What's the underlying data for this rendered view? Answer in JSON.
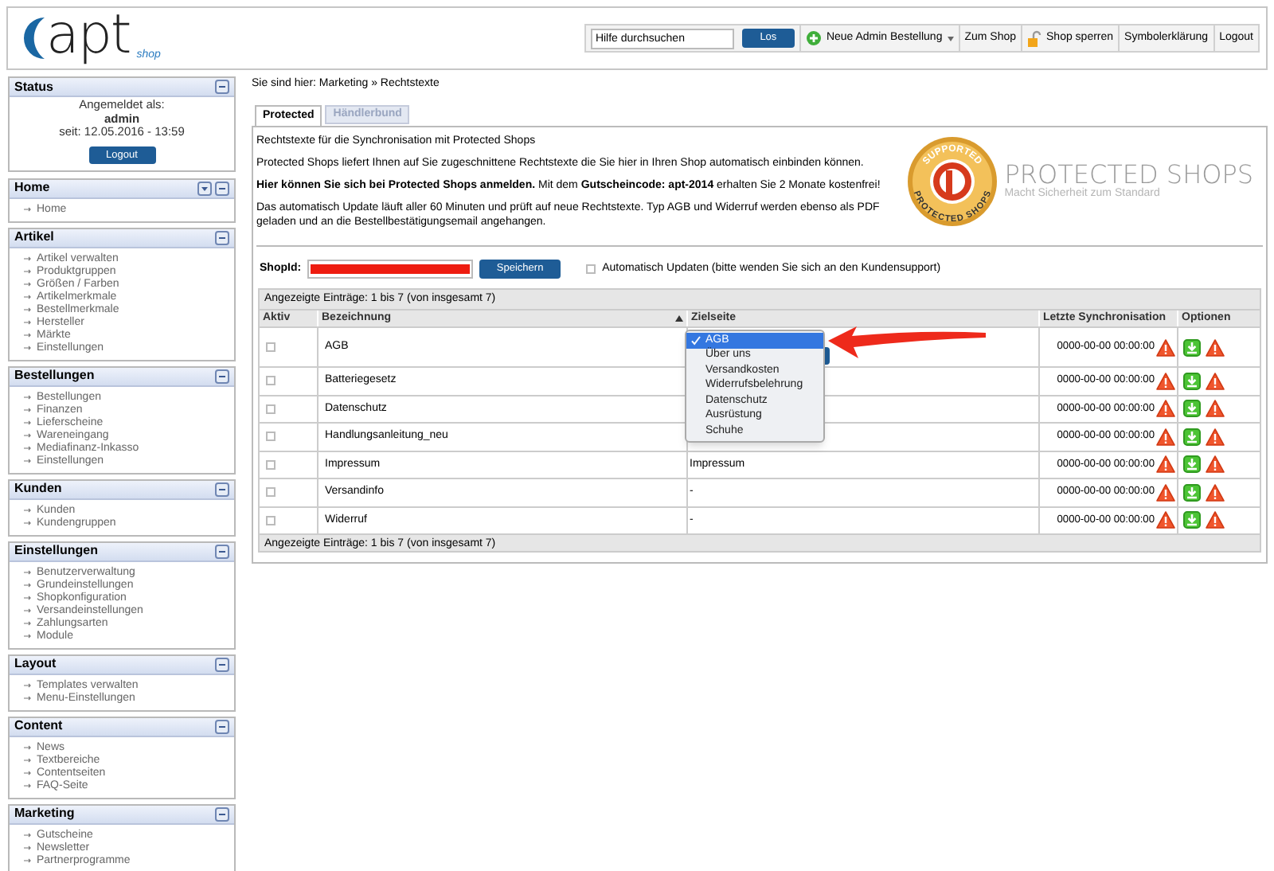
{
  "logo": {
    "brand": "apt",
    "sub": "shop"
  },
  "header": {
    "search": {
      "placeholder": "Hilfe durchsuchen"
    },
    "search_button": "Los",
    "toolbar": [
      {
        "kind": "add",
        "label": "Neue Admin Bestellung",
        "dropdown": true
      },
      {
        "kind": "plain",
        "label": "Zum Shop",
        "dropdown": false
      },
      {
        "kind": "lock",
        "label": "Shop sperren",
        "dropdown": false
      },
      {
        "kind": "plain",
        "label": "Symbolerklärung",
        "dropdown": false
      },
      {
        "kind": "plain",
        "label": "Logout",
        "dropdown": false
      }
    ]
  },
  "sidebar": {
    "status": {
      "title": "Status",
      "line1": "Angemeldet als:",
      "user": "admin",
      "since": "seit: 12.05.2016 - 13:59",
      "button": "Logout"
    },
    "panels": [
      {
        "title": "Home",
        "menu_toggle": true,
        "items": [
          "Home"
        ]
      },
      {
        "title": "Artikel",
        "menu_toggle": false,
        "items": [
          "Artikel verwalten",
          "Produktgruppen",
          "Größen / Farben",
          "Artikelmerkmale",
          "Bestellmerkmale",
          "Hersteller",
          "Märkte",
          "Einstellungen"
        ]
      },
      {
        "title": "Bestellungen",
        "menu_toggle": false,
        "items": [
          "Bestellungen",
          "Finanzen",
          "Lieferscheine",
          "Wareneingang",
          "Mediafinanz-Inkasso",
          "Einstellungen"
        ]
      },
      {
        "title": "Kunden",
        "menu_toggle": false,
        "items": [
          "Kunden",
          "Kundengruppen"
        ]
      },
      {
        "title": "Einstellungen",
        "menu_toggle": false,
        "items": [
          "Benutzerverwaltung",
          "Grundeinstellungen",
          "Shopkonfiguration",
          "Versandeinstellungen",
          "Zahlungsarten",
          "Module"
        ]
      },
      {
        "title": "Layout",
        "menu_toggle": false,
        "items": [
          "Templates verwalten",
          "Menu-Einstellungen"
        ]
      },
      {
        "title": "Content",
        "menu_toggle": false,
        "items": [
          "News",
          "Textbereiche",
          "Contentseiten",
          "FAQ-Seite"
        ]
      },
      {
        "title": "Marketing",
        "menu_toggle": false,
        "items": [
          "Gutscheine",
          "Newsletter",
          "Partnerprogramme"
        ]
      }
    ]
  },
  "breadcrumb": "Sie sind hier: Marketing » Rechtstexte",
  "tabs": [
    {
      "label": "Protected",
      "selected": true
    },
    {
      "label": "Händlerbund",
      "selected": false
    }
  ],
  "intro": [
    "Rechtstexte für die Synchronisation mit Protected Shops",
    "Protected Shops liefert Ihnen auf Sie zugeschnittene Rechtstexte die Sie hier in Ihren Shop automatisch einbinden können.",
    "**Hier können Sie sich bei Protected Shops anmelden.** Mit dem **Gutscheincode: apt-2014** erhalten Sie 2 Monate kostenfrei!",
    "Das automatisch Update läuft aller 60 Minuten und prüft auf neue Rechtstexte. Typ AGB und Widerruf werden ebenso als PDF geladen und an die Bestellbestätigungsemail angehangen."
  ],
  "partner_logo": {
    "seal_top": "SUPPORTED",
    "seal_bottom": "PROTECTED SHOPS",
    "name": "PROTECTED SHOPS",
    "slogan": "Macht Sicherheit zum Standard"
  },
  "shop_id": {
    "label": "ShopId:",
    "redacted": true,
    "button": "Speichern",
    "auto_update": {
      "label": "Automatisch Updaten (bitte wenden Sie sich an den Kundensupport)",
      "checked": false
    }
  },
  "table": {
    "summary_top": "Angezeigte Einträge: 1 bis 7 (von insgesamt 7)",
    "summary_bottom": "Angezeigte Einträge: 1 bis 7 (von insgesamt 7)",
    "columns": [
      {
        "label": "Aktiv",
        "sorted": false
      },
      {
        "label": "Bezeichnung",
        "sorted": true
      },
      {
        "label": "Zielseite",
        "sorted": false
      },
      {
        "label": "Letzte Synchronisation",
        "sorted": false
      },
      {
        "label": "Optionen",
        "sorted": false
      }
    ],
    "rows": [
      {
        "checked": false,
        "name": "AGB",
        "kind": "select",
        "target": "",
        "sync": "0000-00-00 00:00:00"
      },
      {
        "checked": false,
        "name": "Batteriegesetz",
        "kind": "text",
        "target": "",
        "sync": "0000-00-00 00:00:00"
      },
      {
        "checked": false,
        "name": "Datenschutz",
        "kind": "text",
        "target": "",
        "sync": "0000-00-00 00:00:00"
      },
      {
        "checked": false,
        "name": "Handlungsanleitung_neu",
        "kind": "text",
        "target": "",
        "sync": "0000-00-00 00:00:00"
      },
      {
        "checked": false,
        "name": "Impressum",
        "kind": "text",
        "target": "Impressum",
        "sync": "0000-00-00 00:00:00"
      },
      {
        "checked": false,
        "name": "Versandinfo",
        "kind": "text",
        "target": "-",
        "sync": "0000-00-00 00:00:00"
      },
      {
        "checked": false,
        "name": "Widerruf",
        "kind": "text",
        "target": "-",
        "sync": "0000-00-00 00:00:00"
      }
    ],
    "dropdown": {
      "options": [
        {
          "label": "AGB",
          "selected": true
        },
        {
          "label": "Über uns",
          "selected": false
        },
        {
          "label": "Versandkosten",
          "selected": false
        },
        {
          "label": "Widerrufsbelehrung",
          "selected": false
        },
        {
          "label": "Datenschutz",
          "selected": false
        },
        {
          "label": "Ausrüstung",
          "selected": false
        },
        {
          "label": "Schuhe",
          "selected": false
        }
      ]
    }
  }
}
